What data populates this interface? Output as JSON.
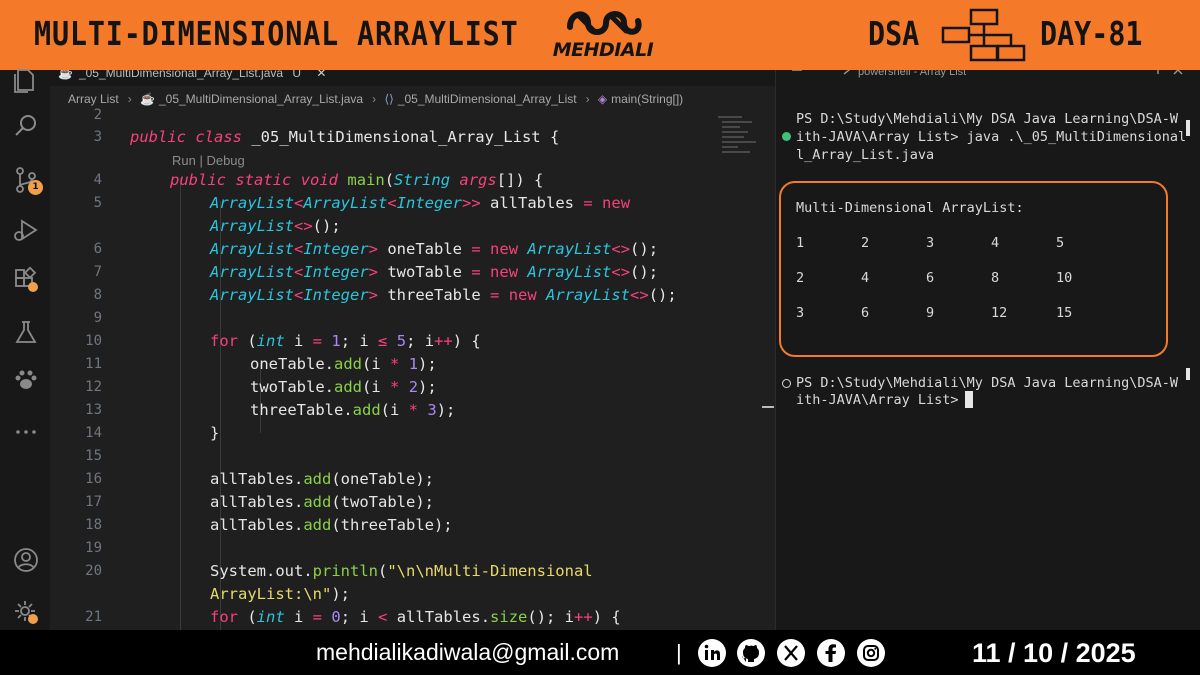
{
  "banner": {
    "title": "MULTI-DIMENSIONAL ARRAYLIST",
    "logo_text": "MEHDIALI",
    "dsa_label": "DSA",
    "day_label": "DAY-81",
    "icons": [
      "mehdiali-logo-icon",
      "tree-diagram-icon"
    ]
  },
  "activity_bar": {
    "items": [
      "explorer-icon",
      "search-icon",
      "source-control-icon",
      "run-debug-icon",
      "extensions-icon",
      "testing-icon",
      "paw-icon",
      "more-icon",
      "account-icon",
      "settings-gear-icon"
    ],
    "source_control_badge": "1"
  },
  "editor": {
    "tab_label": "_05_MultiDimensional_Array_List.java",
    "tab_status": "U",
    "tab_close": "✕",
    "breadcrumb": {
      "folder": "Array List",
      "file": "_05_MultiDimensional_Array_List.java",
      "class": "_05_MultiDimensional_Array_List",
      "method": "main(String[])"
    },
    "codelens": "Run | Debug",
    "line_numbers": [
      "2",
      "3",
      "4",
      "5",
      "6",
      "7",
      "8",
      "9",
      "10",
      "11",
      "12",
      "13",
      "14",
      "15",
      "16",
      "17",
      "18",
      "19",
      "20",
      "21"
    ]
  },
  "terminal": {
    "tab_label": "powershell - Array List",
    "prompt1_line1": "PS D:\\Study\\Mehdiali\\My DSA Java Learning\\DSA-W",
    "prompt1_line2": "ith-JAVA\\Array List> java .\\_05_MultiDimensional",
    "prompt1_line3": "l_Array_List.java",
    "output_title": "Multi-Dimensional ArrayList:",
    "output_rows": [
      [
        "1",
        "2",
        "3",
        "4",
        "5"
      ],
      [
        "2",
        "4",
        "6",
        "8",
        "10"
      ],
      [
        "3",
        "6",
        "9",
        "12",
        "15"
      ]
    ],
    "prompt2_line1": "PS D:\\Study\\Mehdiali\\My DSA Java Learning\\DSA-W",
    "prompt2_line2": "ith-JAVA\\Array List> "
  },
  "footer": {
    "email": "mehdialikadiwala@gmail.com",
    "separator": "|",
    "social_icons": [
      "linkedin-icon",
      "github-icon",
      "x-icon",
      "facebook-icon",
      "instagram-icon"
    ],
    "date": "11 / 10 / 2025"
  },
  "colors": {
    "accent": "#f47a2a",
    "editor_bg": "#1f1f1f",
    "terminal_bg": "#181818",
    "keyword": "#f8417b",
    "type": "#2bc4dc",
    "number": "#a987f5",
    "string": "#e8d96a",
    "method": "#8ad148"
  }
}
